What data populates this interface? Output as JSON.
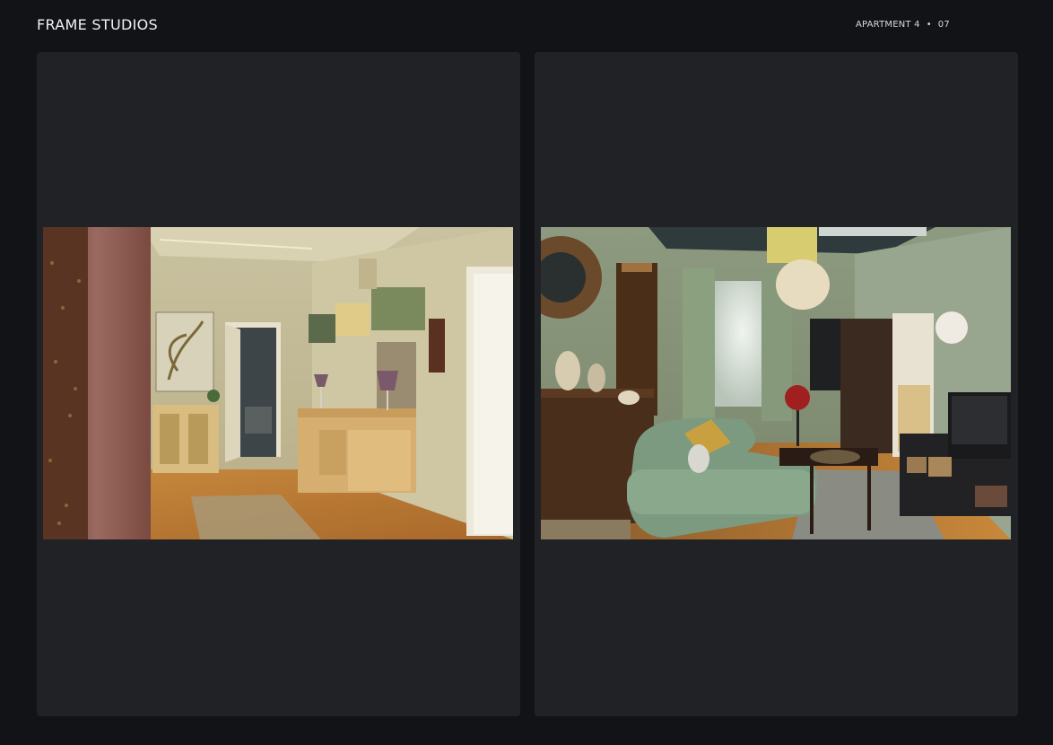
{
  "header": {
    "brand": "FRAME STUDIOS",
    "location": "APARTMENT 4",
    "separator": "•",
    "page_number": "07"
  },
  "colors": {
    "background": "#111317",
    "panel": "#212226",
    "text": "#f2f2f2"
  },
  "photos": [
    {
      "subject": "hallway-with-sideboard-photo"
    },
    {
      "subject": "living-room-with-green-sofa-photo"
    }
  ]
}
